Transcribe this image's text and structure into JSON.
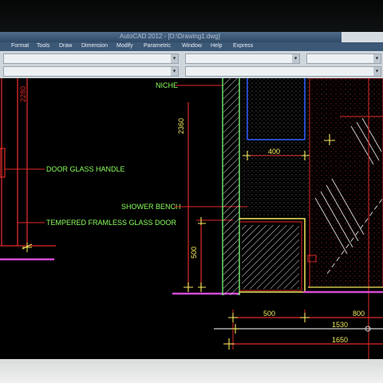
{
  "app": {
    "title": "AutoCAD 2012 - [D:\\Drawing1.dwg]",
    "menu": [
      "Format",
      "Tools",
      "Draw",
      "Dimension",
      "Modify",
      "Parametric",
      "Window",
      "Help",
      "Express"
    ]
  },
  "drawing": {
    "labels": {
      "niche": "NICHE",
      "door_glass_handle": "DOOR GLASS HANDLE",
      "shower_bench": "SHOWER BENCH",
      "tempered_door": "TEMPERED FRAMLESS GLASS DOOR"
    },
    "dimensions": {
      "d2280": "2280",
      "d2360": "2360",
      "d500v": "500",
      "d400": "400",
      "d500h": "500",
      "d800": "800",
      "d1530": "1530",
      "d1650": "1650"
    }
  },
  "colors": {
    "dim_red": "#e12a2a",
    "dim_text_yellow": "#f2e85a",
    "label_green": "#8cff5c",
    "wall_green": "#7cff7c",
    "niche_blue": "#2a5cff",
    "floor_magenta": "#d44bd4",
    "hatch_white": "#d9d9d9"
  }
}
